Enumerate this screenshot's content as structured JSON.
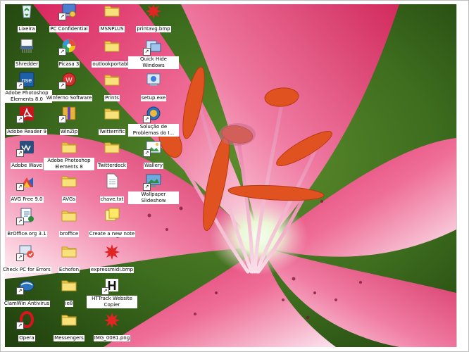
{
  "desktop": {
    "icons": [
      {
        "label": "Lixeira",
        "icon": "recycle-bin-icon",
        "shortcut": false
      },
      {
        "label": "PC Confidential",
        "icon": "pc-lock-icon",
        "shortcut": true
      },
      {
        "label": "MSNPLUS",
        "icon": "folder-icon",
        "shortcut": false
      },
      {
        "label": "printavg.bmp",
        "icon": "bmp-splash-icon",
        "shortcut": false
      },
      {
        "label": "Shredder",
        "icon": "shredder-icon",
        "shortcut": false
      },
      {
        "label": "Picasa 3",
        "icon": "picasa-icon",
        "shortcut": true
      },
      {
        "label": "outlookportable",
        "icon": "folder-icon",
        "shortcut": false
      },
      {
        "label": "Quick Hide Windows",
        "icon": "quick-hide-icon",
        "shortcut": true
      },
      {
        "label": "Adobe Photoshop Elements 8.0",
        "icon": "photoshop-elements-icon",
        "shortcut": true
      },
      {
        "label": "Winferno Software",
        "icon": "winferno-icon",
        "shortcut": true
      },
      {
        "label": "Prints",
        "icon": "folder-icon",
        "shortcut": false
      },
      {
        "label": "setup.exe",
        "icon": "setup-icon",
        "shortcut": false
      },
      {
        "label": "Adobe Reader 9",
        "icon": "adobe-reader-icon",
        "shortcut": true
      },
      {
        "label": "WinZip",
        "icon": "winzip-icon",
        "shortcut": true
      },
      {
        "label": "Twitterrific",
        "icon": "folder-icon",
        "shortcut": false
      },
      {
        "label": "Solução de Problemas do I...",
        "icon": "troubleshoot-icon",
        "shortcut": true
      },
      {
        "label": "Adobe Wave",
        "icon": "adobe-wave-icon",
        "shortcut": true
      },
      {
        "label": "Adobe Photoshop Elements 8",
        "icon": "folder-icon",
        "shortcut": false
      },
      {
        "label": "Twitterdeck",
        "icon": "folder-icon",
        "shortcut": false
      },
      {
        "label": "Wallery",
        "icon": "wallery-icon",
        "shortcut": true
      },
      {
        "label": "AVG Free 9.0",
        "icon": "avg-icon",
        "shortcut": true
      },
      {
        "label": "AVGs",
        "icon": "folder-icon",
        "shortcut": false
      },
      {
        "label": "chave.txt",
        "icon": "text-file-icon",
        "shortcut": false
      },
      {
        "label": "Wallpaper Slideshow",
        "icon": "wallpaper-slideshow-icon",
        "shortcut": true
      },
      {
        "label": "BrOffice.org 3.1",
        "icon": "broffice-icon",
        "shortcut": true
      },
      {
        "label": "broffice",
        "icon": "folder-icon",
        "shortcut": false
      },
      {
        "label": "Create a new note",
        "icon": "sticky-note-icon",
        "shortcut": false
      },
      {
        "label": "Check PC for Errors",
        "icon": "check-pc-icon",
        "shortcut": true
      },
      {
        "label": "Echofon",
        "icon": "folder-icon",
        "shortcut": false
      },
      {
        "label": "expressmidi.bmp",
        "icon": "bmp-splash-icon",
        "shortcut": false
      },
      {
        "label": "ClamWin Antivirus",
        "icon": "clamwin-icon",
        "shortcut": true
      },
      {
        "label": "ie8",
        "icon": "folder-icon",
        "shortcut": false
      },
      {
        "label": "HTTrack Website Copier",
        "icon": "httrack-icon",
        "shortcut": true
      },
      {
        "label": "Opera",
        "icon": "opera-icon",
        "shortcut": true
      },
      {
        "label": "Messengers",
        "icon": "folder-icon",
        "shortcut": false
      },
      {
        "label": "IMG_0081.png",
        "icon": "bmp-splash-icon",
        "shortcut": false
      }
    ]
  }
}
